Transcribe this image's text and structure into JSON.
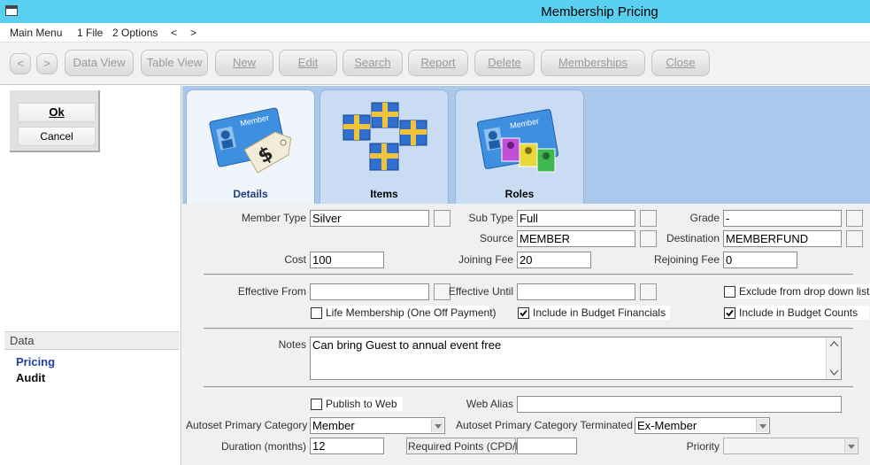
{
  "window": {
    "title": "Membership Pricing"
  },
  "menu": {
    "items": [
      "Main Menu",
      "1 File",
      "2 Options",
      "<",
      ">"
    ]
  },
  "toolbar": {
    "prev_label": "<",
    "next_label": ">",
    "data_view": "Data View",
    "table_view": "Table View",
    "new": "New",
    "edit": "Edit",
    "search": "Search",
    "report": "Report",
    "delete": "Delete",
    "memberships": "Memberships",
    "close": "Close"
  },
  "dialog": {
    "ok": "Ok",
    "cancel": "Cancel"
  },
  "data_section": {
    "header": "Data",
    "links": [
      "Pricing",
      "Audit"
    ]
  },
  "tabs": [
    {
      "label": "Details",
      "icon": "member-card-price-tag-icon"
    },
    {
      "label": "Items",
      "icon": "gift-boxes-icon"
    },
    {
      "label": "Roles",
      "icon": "member-roles-icon"
    }
  ],
  "tab_card": {
    "member_text": "Member"
  },
  "form": {
    "member_type": {
      "label": "Member Type",
      "value": "Silver"
    },
    "sub_type": {
      "label": "Sub Type",
      "value": "Full"
    },
    "grade": {
      "label": "Grade",
      "value": "-"
    },
    "source": {
      "label": "Source",
      "value": "MEMBER"
    },
    "destination": {
      "label": "Destination",
      "value": "MEMBERFUND"
    },
    "cost": {
      "label": "Cost",
      "value": "100"
    },
    "joining_fee": {
      "label": "Joining Fee",
      "value": "20"
    },
    "rejoining_fee": {
      "label": "Rejoining Fee",
      "value": "0"
    },
    "effective_from": {
      "label": "Effective From",
      "value": ""
    },
    "effective_until": {
      "label": "Effective Until",
      "value": ""
    },
    "exclude_dropdown": {
      "label": "Exclude from drop down lists",
      "checked": false
    },
    "life_membership": {
      "label": "Life Membership (One Off Payment)",
      "checked": false
    },
    "budget_financials": {
      "label": "Include in Budget Financials",
      "checked": true
    },
    "budget_counts": {
      "label": "Include in Budget Counts",
      "checked": true
    },
    "notes": {
      "label": "Notes",
      "value": "Can bring Guest to annual event free"
    },
    "publish_web": {
      "label": "Publish to Web",
      "checked": false
    },
    "web_alias": {
      "label": "Web Alias",
      "value": ""
    },
    "autoset_primary": {
      "label": "Autoset Primary Category",
      "value": "Member"
    },
    "autoset_terminated": {
      "label": "Autoset Primary Category Terminated",
      "value": "Ex-Member"
    },
    "duration": {
      "label": "Duration (months)",
      "value": "12"
    },
    "required_points": {
      "label": "Required Points (CPD/E)",
      "value": ""
    },
    "priority": {
      "label": "Priority",
      "value": ""
    }
  }
}
